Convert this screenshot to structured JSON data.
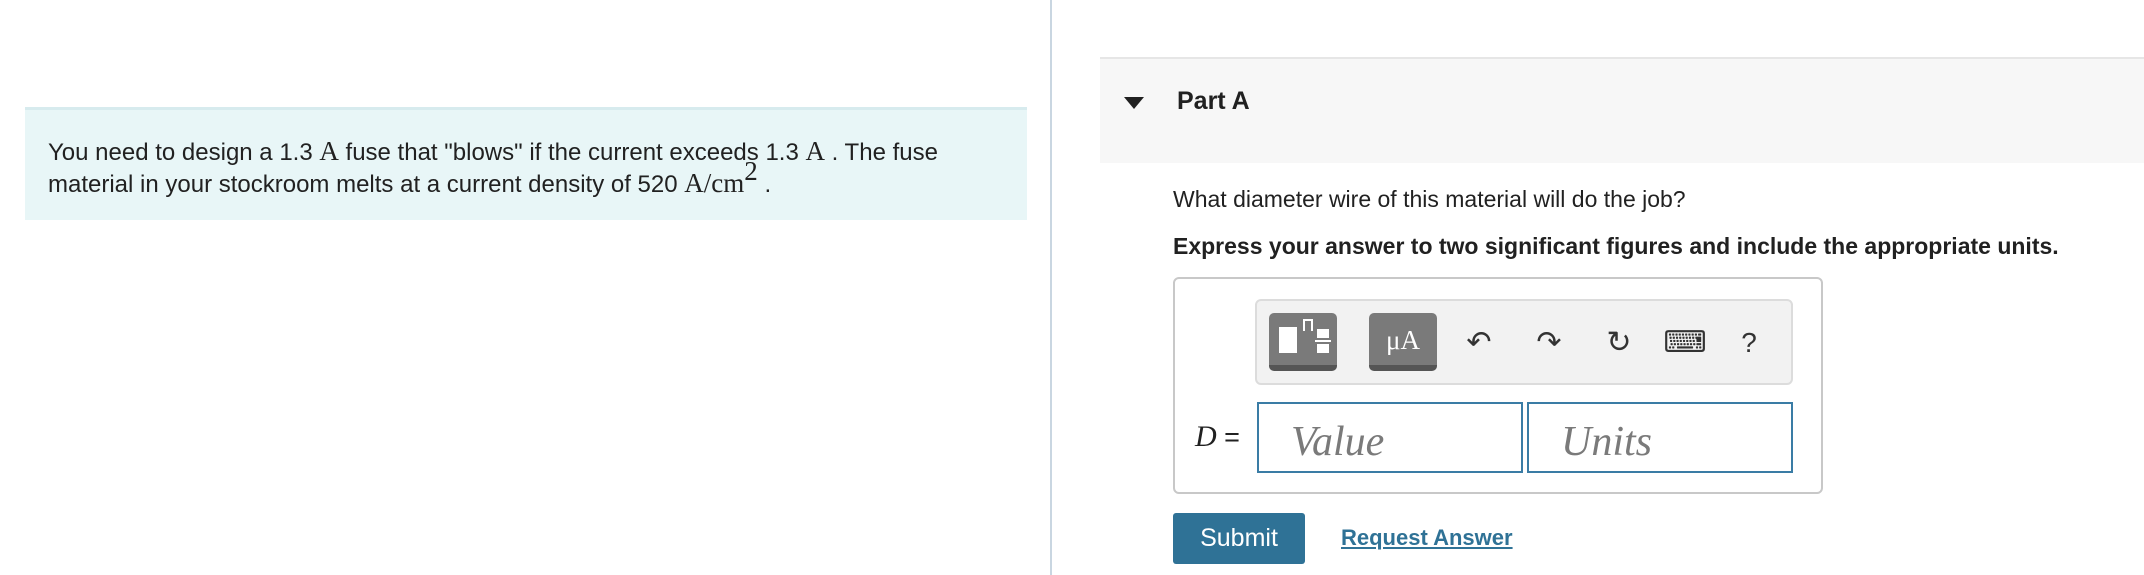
{
  "problem": {
    "t1": "You need to design a 1.3 ",
    "unitA1": "A",
    "t2": " fuse that \"blows\" if the current exceeds 1.3 ",
    "unitA2": "A",
    "t3": " . The fuse material in your stockroom melts at a current density of 520 ",
    "density_unit": "A/cm",
    "exponent": "2",
    "t4": " ."
  },
  "part": {
    "title": "Part A"
  },
  "question": "What diameter wire of this material will do the job?",
  "instruction": "Express your answer to two significant figures and include the appropriate units.",
  "toolbar": {
    "units_label": "μA",
    "undo_icon": "↶",
    "redo_icon": "↷",
    "reset_icon": "↻",
    "keyboard_icon": "⌨",
    "help_label": "?"
  },
  "answer": {
    "variable": "D",
    "equals": " =",
    "value_placeholder": "Value",
    "units_placeholder": "Units"
  },
  "actions": {
    "submit_label": "Submit",
    "request_label": "Request Answer"
  },
  "colors": {
    "problem_bg": "#e8f6f7",
    "accent": "#2f7296",
    "field_border": "#3a7ca5"
  }
}
